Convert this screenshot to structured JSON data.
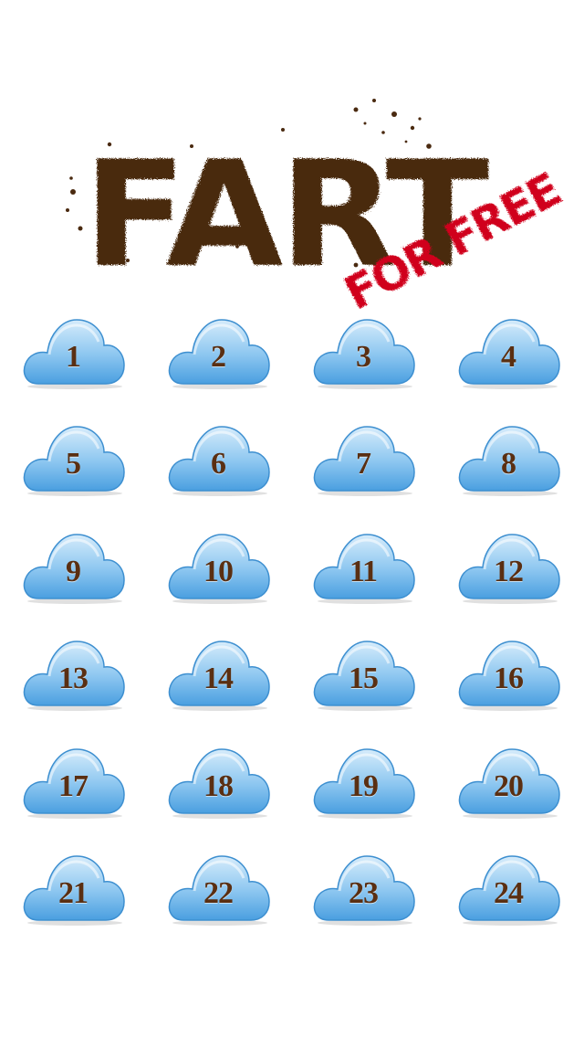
{
  "logo": {
    "title": "FART",
    "subtitle": "FOR FREE",
    "title_color": "#4a2a10",
    "subtitle_color": "#d0021b"
  },
  "buttons": [
    {
      "label": "1"
    },
    {
      "label": "2"
    },
    {
      "label": "3"
    },
    {
      "label": "4"
    },
    {
      "label": "5"
    },
    {
      "label": "6"
    },
    {
      "label": "7"
    },
    {
      "label": "8"
    },
    {
      "label": "9"
    },
    {
      "label": "10"
    },
    {
      "label": "11"
    },
    {
      "label": "12"
    },
    {
      "label": "13"
    },
    {
      "label": "14"
    },
    {
      "label": "15"
    },
    {
      "label": "16"
    },
    {
      "label": "17"
    },
    {
      "label": "18"
    },
    {
      "label": "19"
    },
    {
      "label": "20"
    },
    {
      "label": "21"
    },
    {
      "label": "22"
    },
    {
      "label": "23"
    },
    {
      "label": "24"
    }
  ],
  "colors": {
    "cloud_light": "#d6ecfb",
    "cloud_mid": "#8cc6f0",
    "cloud_dark": "#4a9fe0",
    "label": "#5a2f12"
  }
}
